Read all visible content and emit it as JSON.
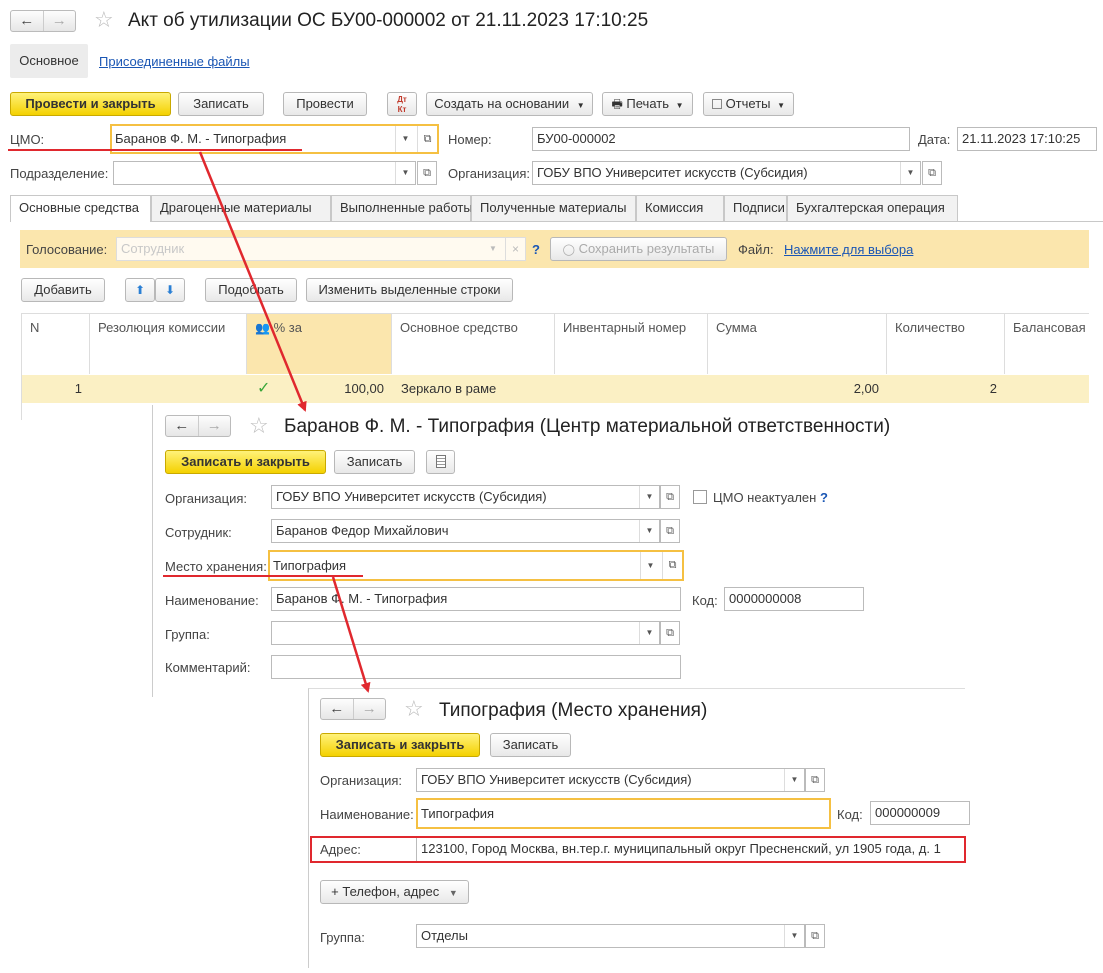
{
  "doc": {
    "title": "Акт об утилизации ОС БУ00-000002 от 21.11.2023 17:10:25",
    "section_main": "Основное",
    "section_files": "Присоединенные файлы",
    "toolbar": {
      "post_close": "Провести и закрыть",
      "save": "Записать",
      "post": "Провести",
      "dtkt_top": "Дт",
      "dtkt_bottom": "Кт",
      "create_based": "Создать на основании",
      "print": "Печать",
      "reports": "Отчеты"
    },
    "fields": {
      "cmo_label": "ЦМО:",
      "cmo_value": "Баранов Ф. М. - Типография",
      "number_label": "Номер:",
      "number_value": "БУ00-000002",
      "date_label": "Дата:",
      "date_value": "21.11.2023 17:10:25",
      "division_label": "Подразделение:",
      "division_value": "",
      "org_label": "Организация:",
      "org_value": "ГОБУ ВПО Университет искусств (Субсидия)"
    },
    "tabs": [
      "Основные средства",
      "Драгоценные материалы",
      "Выполненные работы",
      "Полученные материалы",
      "Комиссия",
      "Подписи",
      "Бухгалтерская операция"
    ],
    "voting": {
      "label": "Голосование:",
      "placeholder": "Сотрудник",
      "help": "?",
      "save_results": "Сохранить результаты",
      "file_label": "Файл:",
      "file_link": "Нажмите для выбора"
    },
    "table_toolbar": {
      "add": "Добавить",
      "pick": "Подобрать",
      "change_rows": "Изменить выделенные строки"
    },
    "table": {
      "columns": [
        "N",
        "Резолюция комиссии",
        "% за",
        "Основное средство",
        "Инвентарный номер",
        "Сумма",
        "Количество",
        "Балансовая"
      ],
      "rows": [
        {
          "n": "1",
          "resolution": "",
          "percent": "100,00",
          "asset": "Зеркало в раме",
          "inventory": "",
          "sum": "2,00",
          "qty": "2",
          "balance": ""
        }
      ]
    }
  },
  "cmo_form": {
    "title": "Баранов Ф. М. - Типография (Центр материальной ответственности)",
    "save_close": "Записать и закрыть",
    "save": "Записать",
    "org_label": "Организация:",
    "org_value": "ГОБУ ВПО Университет искусств (Субсидия)",
    "inactive_label": "ЦМО неактуален",
    "help": "?",
    "employee_label": "Сотрудник:",
    "employee_value": "Баранов Федор Михайлович",
    "storage_label": "Место хранения:",
    "storage_value": "Типография",
    "name_label": "Наименование:",
    "name_value": "Баранов Ф. М. - Типография",
    "code_label": "Код:",
    "code_value": "0000000008",
    "group_label": "Группа:",
    "group_value": "",
    "comment_label": "Комментарий:",
    "comment_value": ""
  },
  "storage_form": {
    "title": "Типография (Место хранения)",
    "save_close": "Записать и закрыть",
    "save": "Записать",
    "org_label": "Организация:",
    "org_value": "ГОБУ ВПО Университет искусств (Субсидия)",
    "name_label": "Наименование:",
    "name_value": "Типография",
    "code_label": "Код:",
    "code_value": "000000009",
    "address_label": "Адрес:",
    "address_value": "123100, Город Москва, вн.тер.г. муниципальный округ Пресненский, ул 1905 года, д. 1",
    "phone_button": "+ Телефон, адрес",
    "group_label": "Группа:",
    "group_value": "Отделы"
  },
  "colors": {
    "accent_yellow": "#f4d100",
    "highlight_border": "#f5c042",
    "annotation_red": "#e0282e",
    "voting_bar": "#fbe6ad",
    "selected_row": "#fbf0c4",
    "link": "#1a56b4"
  }
}
